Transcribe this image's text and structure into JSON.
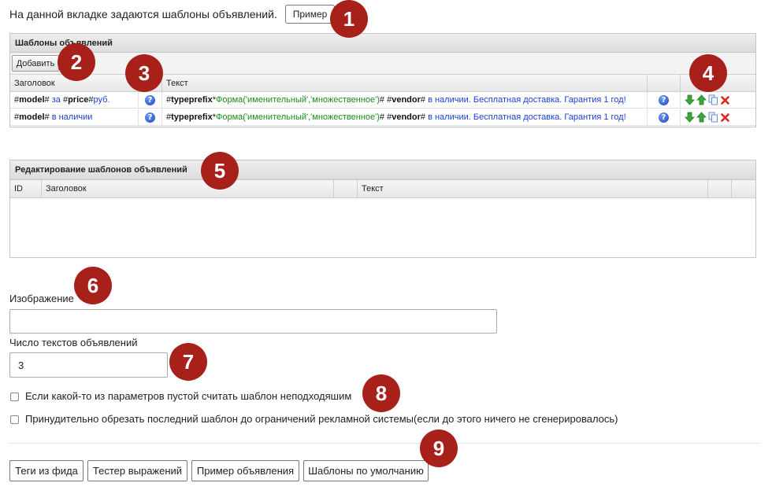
{
  "intro": {
    "text": "На данной вкладке задаются шаблоны объявлений.",
    "example_button": "Пример"
  },
  "templates": {
    "title": "Шаблоны объявлений",
    "add_button": "Добавить",
    "columns": {
      "heading": "Заголовок",
      "text": "Текст"
    },
    "rows": [
      {
        "heading": [
          {
            "t": "#",
            "s": "var"
          },
          {
            "t": "model",
            "s": "varb"
          },
          {
            "t": "#",
            "s": "var"
          },
          {
            "t": " за ",
            "s": "blue"
          },
          {
            "t": "#",
            "s": "var"
          },
          {
            "t": "price",
            "s": "varb"
          },
          {
            "t": "#",
            "s": "var"
          },
          {
            "t": "руб.",
            "s": "blue"
          }
        ],
        "text": [
          {
            "t": "#",
            "s": "var"
          },
          {
            "t": "typeprefix",
            "s": "varb"
          },
          {
            "t": "*",
            "s": "var"
          },
          {
            "t": "Форма('именительный','множественное')",
            "s": "green"
          },
          {
            "t": "# ",
            "s": "var"
          },
          {
            "t": "#",
            "s": "var"
          },
          {
            "t": "vendor",
            "s": "varb"
          },
          {
            "t": "#",
            "s": "var"
          },
          {
            "t": " в наличии. Бесплатная доставка. Гарантия 1 год!",
            "s": "blue"
          }
        ]
      },
      {
        "heading": [
          {
            "t": "#",
            "s": "var"
          },
          {
            "t": "model",
            "s": "varb"
          },
          {
            "t": "#",
            "s": "var"
          },
          {
            "t": " в наличии",
            "s": "blue"
          }
        ],
        "text": [
          {
            "t": "#",
            "s": "var"
          },
          {
            "t": "typeprefix",
            "s": "varb"
          },
          {
            "t": "*",
            "s": "var"
          },
          {
            "t": "Форма('именительный','множественное')",
            "s": "green"
          },
          {
            "t": "# ",
            "s": "var"
          },
          {
            "t": "#",
            "s": "var"
          },
          {
            "t": "vendor",
            "s": "varb"
          },
          {
            "t": "#",
            "s": "var"
          },
          {
            "t": " в наличии. Бесплатная доставка. Гарантия 1 год!",
            "s": "blue"
          }
        ]
      }
    ],
    "row_actions": [
      "move-down-icon",
      "move-up-icon",
      "copy-icon",
      "delete-icon"
    ],
    "help_icon": "help-icon"
  },
  "edit": {
    "title": "Редактирование шаблонов объявлений",
    "columns": {
      "id": "ID",
      "heading": "Заголовок",
      "text": "Текст"
    }
  },
  "form": {
    "image_label": "Изображение",
    "image_value": "",
    "count_label": "Число текстов объявлений",
    "count_value": "3",
    "check1_label": "Если какой-то из параметров пустой считать шаблон неподходяшим",
    "check2_label": "Принудительно обрезать последний шаблон до ограничений рекламной системы(если до этого ничего не сгенерировалось)"
  },
  "buttons": {
    "feed_tags": "Теги из фида",
    "expr_tester": "Тестер выражений",
    "ad_example": "Пример объявления",
    "default_templates": "Шаблоны по умолчанию"
  },
  "badges": [
    "1",
    "2",
    "3",
    "4",
    "5",
    "6",
    "7",
    "8",
    "9"
  ],
  "colors": {
    "badge": "#a8201a",
    "link_blue": "#1a3fd0",
    "func_green": "#1c8a1c"
  }
}
